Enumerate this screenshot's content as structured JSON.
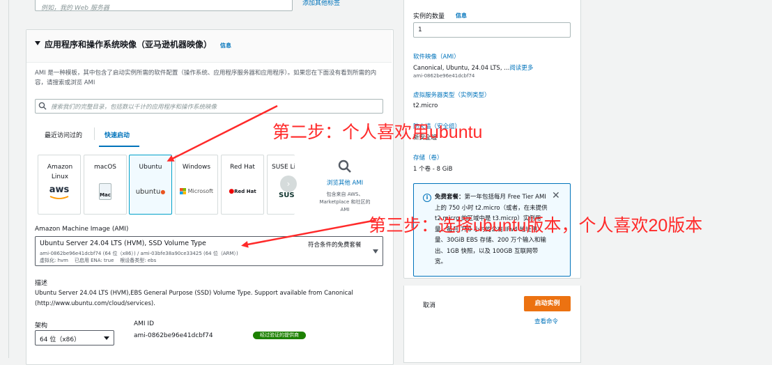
{
  "top": {
    "name_placeholder": "例如，我的 Web 服务器",
    "add_tag_link": "添加其他标签"
  },
  "ami_section": {
    "title": "应用程序和操作系统映像（亚马逊机器映像）",
    "info_link": "信息",
    "description": "AMI 是一种模板，其中包含了启动实例所需的软件配置（操作系统、应用程序服务器和应用程序）。如果您在下面没有看到所需的内容，请搜索或浏览 AMI",
    "search_placeholder": "搜索我们的完整目录，包括数以千计的应用程序和操作系统映像",
    "tabs": [
      "最近访问过的",
      "快速启动"
    ],
    "tiles": [
      {
        "name": "Amazon Linux",
        "logo": "aws"
      },
      {
        "name": "macOS",
        "logo": "Mac"
      },
      {
        "name": "Ubuntu",
        "logo": "ubuntu"
      },
      {
        "name": "Windows",
        "logo": "Microsoft"
      },
      {
        "name": "Red Hat",
        "logo": "Red Hat"
      },
      {
        "name": "SUSE Li",
        "logo": "SUS"
      }
    ],
    "browse": {
      "label": "浏览其他 AMI",
      "desc": "包含来自 AWS、Marketplace 和社区的 AMI"
    },
    "ami_label": "Amazon Machine Image (AMI)",
    "ami_select": {
      "name": "Ubuntu Server 24.04 LTS (HVM), SSD Volume Type",
      "ids": "ami-0862be96e41dcbf74 (64 位（x86）) / ami-03bfe38a90ce33425 (64 位（ARM）)",
      "meta": "虚拟化: hvm    已启用 ENA: true    根设备类型: ebs",
      "free_tag": "符合条件的免费套餐"
    },
    "desc_label": "描述",
    "desc_text_1": "Ubuntu Server 24.04 LTS (HVM),EBS General Purpose (SSD) Volume Type. Support available from Canonical",
    "desc_text_2": "(http://www.ubuntu.com/cloud/services).",
    "arch_label": "架构",
    "arch_value": "64 位（x86）",
    "ami_id_label": "AMI ID",
    "ami_id_value": "ami-0862be96e41dcbf74",
    "verified_badge": "经过验证的提供商"
  },
  "summary": {
    "instance_count_label": "实例的数量",
    "info_link": "信息",
    "instance_count_value": "1",
    "software_image_label": "软件映像（AMI）",
    "software_image_value": "Canonical, Ubuntu, 24.04 LTS, ...",
    "read_more": "阅读更多",
    "software_image_id": "ami-0862be96e41dcbf74",
    "server_type_label": "虚拟服务器类型（实例类型）",
    "server_type_value": "t2.micro",
    "firewall_label": "防火墙（安全组）",
    "firewall_value": "新安全组",
    "storage_label": "存储（卷）",
    "storage_value": "1 个卷 - 8 GiB",
    "free_tier": {
      "title": "免费套餐：",
      "text": "第一年包括每月 Free Tier AMI 上的 750 小时 t2.micro（或者，在未提供 t2.micro 的区域中是 t3.micro）实例用量、每月 750 小时的公有 IPv4 地址用量、30GiB EBS 存储、200 万个输入和输出、1GB 快照，以及 100GB 互联网带宽。"
    },
    "cancel": "取消",
    "launch": "启动实例",
    "view_commands": "查看命令"
  },
  "annotations": {
    "step2": "第二步：个人喜欢用ubuntu",
    "step3": "第三步：选择ubuntu版本，个人喜欢20版本"
  }
}
